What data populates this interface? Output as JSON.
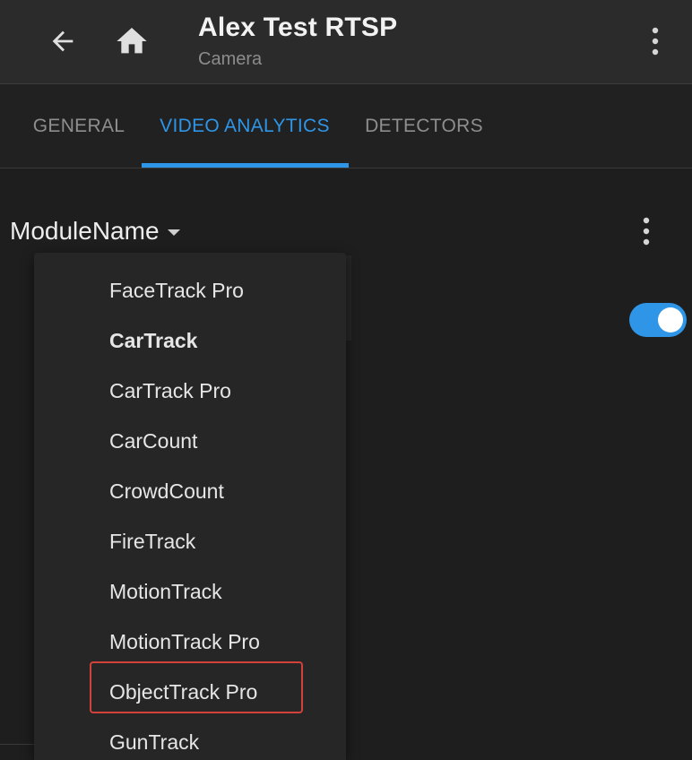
{
  "appbar": {
    "title": "Alex Test RTSP",
    "subtitle": "Camera",
    "back_icon": "arrow-left-icon",
    "home_icon": "home-icon",
    "more_icon": "more-vertical-icon"
  },
  "tabs": [
    {
      "label": "GENERAL",
      "active": false
    },
    {
      "label": "VIDEO ANALYTICS",
      "active": true
    },
    {
      "label": "DETECTORS",
      "active": false
    }
  ],
  "module_selector": {
    "label": "ModuleName",
    "icon": "caret-down-icon"
  },
  "toggle": {
    "state": "on"
  },
  "menu": {
    "items": [
      {
        "label": "FaceTrack Pro"
      },
      {
        "label": "CarTrack"
      },
      {
        "label": "CarTrack Pro"
      },
      {
        "label": "CarCount"
      },
      {
        "label": "CrowdCount"
      },
      {
        "label": "FireTrack"
      },
      {
        "label": "MotionTrack"
      },
      {
        "label": "MotionTrack Pro"
      },
      {
        "label": "ObjectTrack Pro",
        "highlighted": true
      },
      {
        "label": "GunTrack"
      }
    ]
  },
  "colors": {
    "accent": "#2f95e6",
    "highlight_border": "#d2413a",
    "background": "#1e1e1e",
    "appbar": "#2b2b2b",
    "menu": "#262626"
  }
}
